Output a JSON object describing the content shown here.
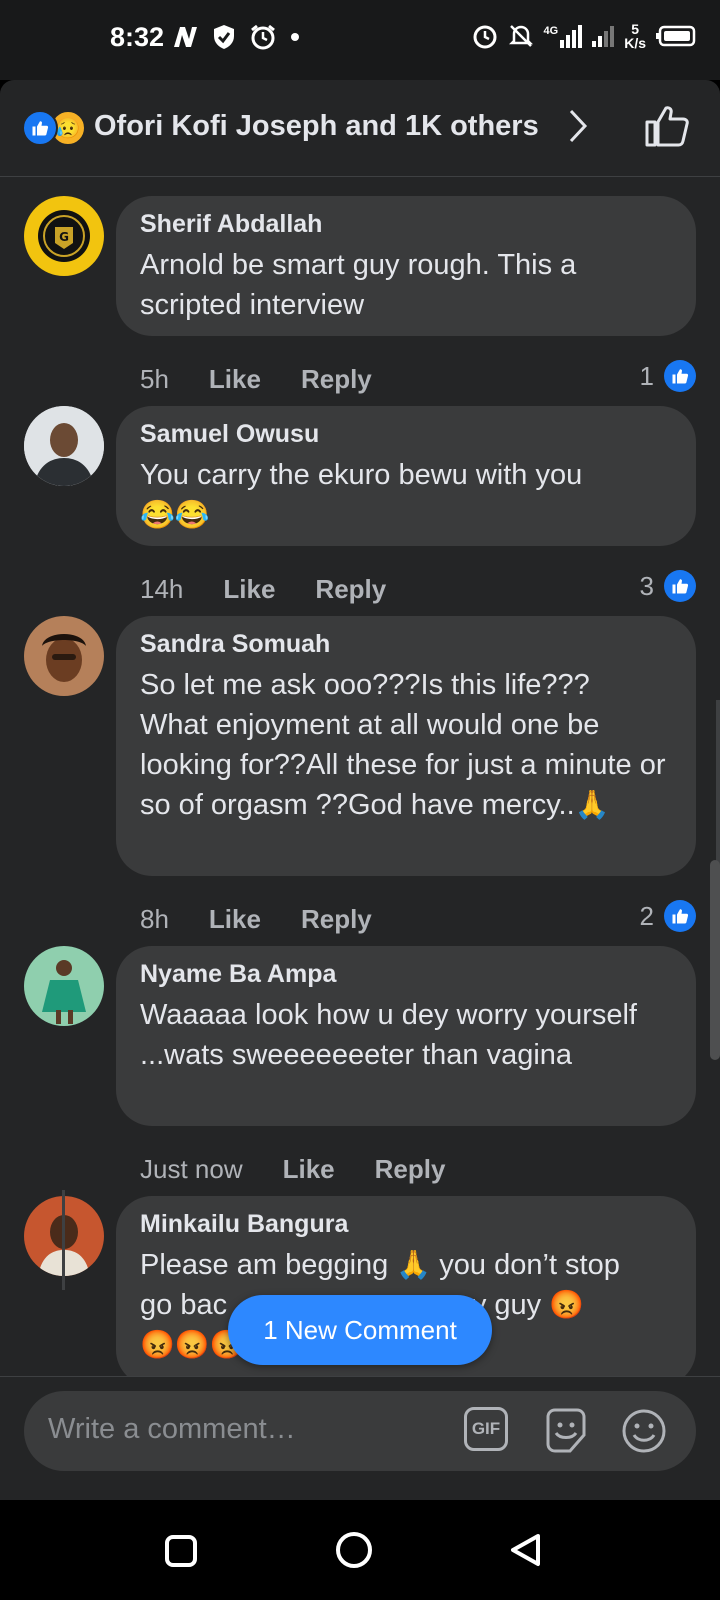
{
  "status_bar": {
    "time": "8:32",
    "net_speed_top": "5",
    "net_speed_bottom": "K/s",
    "network": "4G"
  },
  "header": {
    "reactors_text": "Ofori Kofi Joseph and 1K others"
  },
  "comments": [
    {
      "author": "Sherif Abdallah",
      "text": "Arnold be smart guy rough. This a scripted interview",
      "time": "5h",
      "like_label": "Like",
      "reply_label": "Reply",
      "like_count": "1"
    },
    {
      "author": "Samuel Owusu",
      "text": "You carry the ekuro bewu with you",
      "emojis": "😂😂",
      "time": "14h",
      "like_label": "Like",
      "reply_label": "Reply",
      "like_count": "3"
    },
    {
      "author": "Sandra Somuah",
      "text": "So let me ask ooo???Is this life???\nWhat enjoyment at all would one be looking for??All these for just a minute or so of orgasm ??God have mercy..",
      "emojis": "🙏",
      "time": "8h",
      "like_label": "Like",
      "reply_label": "Reply",
      "like_count": "2"
    },
    {
      "author": "Nyame Ba Ampa",
      "text": "Waaaaa look how u dey worry yourself ...wats sweeeeeeeter than vagina",
      "time": "Just now",
      "like_label": "Like",
      "reply_label": "Reply"
    },
    {
      "author": "Minkailu Bangura",
      "text_line1": "Please am begging",
      "text_line1_emoji": "🙏",
      "text_line1_rest": "you don’t stop",
      "text_line2a": "go bac",
      "text_line2b": "st my guy",
      "text_line2_emoji": "😡",
      "text_line3_emojis": "😡😡😡"
    }
  ],
  "new_comment_pill": "1 New Comment",
  "composer": {
    "placeholder": "Write a comment…",
    "gif_label": "GIF"
  },
  "colors": {
    "accent": "#1877f2",
    "pill": "#2d88ff",
    "bubble": "#3a3b3c",
    "sheet": "#242526"
  }
}
